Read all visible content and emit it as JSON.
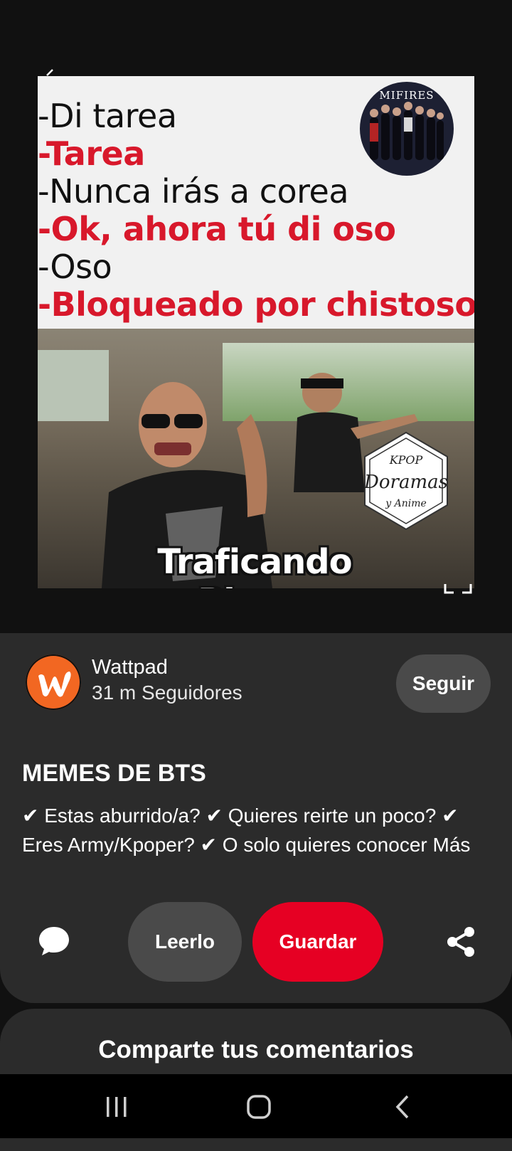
{
  "pin": {
    "meme_lines": [
      {
        "text": "-Di tarea",
        "color": "#111111"
      },
      {
        "text": "-Tarea",
        "color": "#d8182b"
      },
      {
        "text": "-Nunca irás a corea",
        "color": "#111111"
      },
      {
        "text": "-Ok, ahora tú di oso",
        "color": "#d8182b"
      },
      {
        "text": "-Oso",
        "color": "#111111"
      },
      {
        "text": "-Bloqueado por chistoso",
        "color": "#d8182b"
      }
    ],
    "logo_text": "MIFIRES",
    "badge": {
      "top": "KPOP",
      "middle": "Doramas",
      "bottom": "y Anime"
    },
    "caption": "Traficando Rimas"
  },
  "creator": {
    "name": "Wattpad",
    "followers": "31 m Seguidores",
    "follow_label": "Seguir",
    "avatar_letter": "w",
    "avatar_color": "#f26722"
  },
  "details": {
    "title": "MEMES DE BTS",
    "description": "✔ Estas aburrido/a? ✔ Quieres reirte un poco? ✔ Eres Army/Kpoper? ✔ O solo quieres conocer Más"
  },
  "actions": {
    "read_label": "Leerlo",
    "save_label": "Guardar",
    "save_color": "#e60023"
  },
  "comments": {
    "heading": "Comparte tus comentarios"
  },
  "icons": {
    "comment": "comment-icon",
    "share": "share-icon",
    "recents": "nav-recents-icon",
    "home": "nav-home-icon",
    "back": "nav-back-icon"
  }
}
